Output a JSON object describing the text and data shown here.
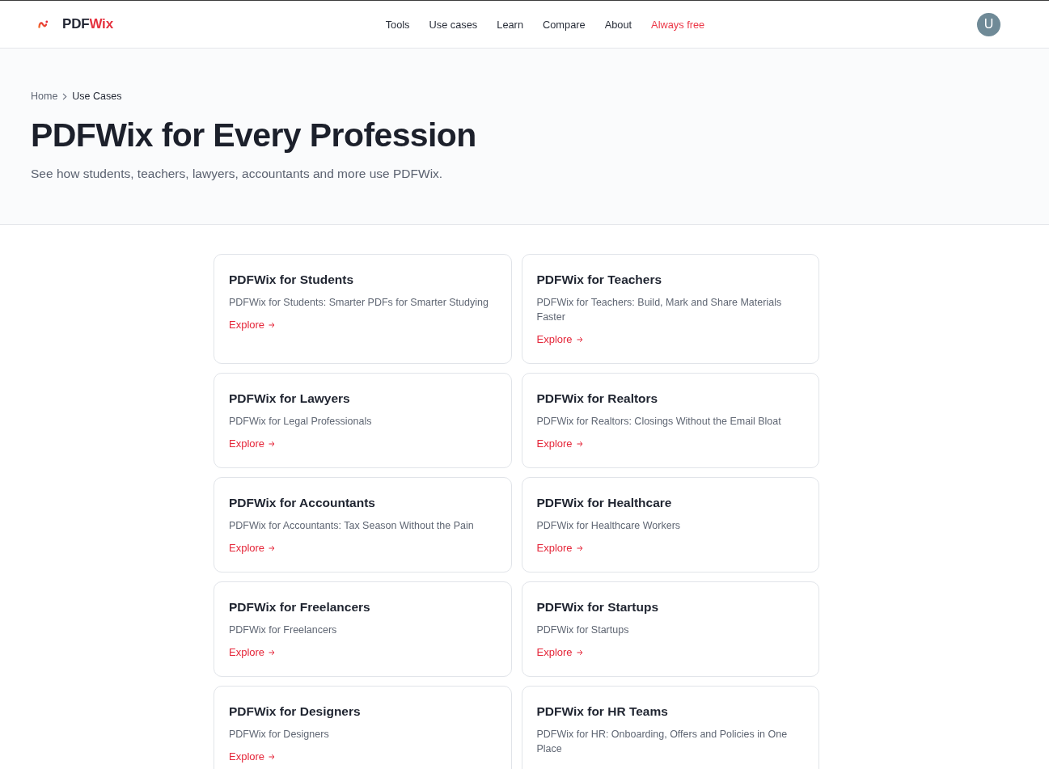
{
  "header": {
    "logo": {
      "first": "PDF",
      "second": "Wix"
    },
    "nav": [
      {
        "label": "Tools",
        "kind": "plain"
      },
      {
        "label": "Use cases",
        "kind": "plain"
      },
      {
        "label": "Learn",
        "kind": "plain"
      },
      {
        "label": "Compare",
        "kind": "plain"
      },
      {
        "label": "About",
        "kind": "plain"
      },
      {
        "label": "Always free",
        "kind": "accent"
      }
    ],
    "avatar": {
      "initial": "U"
    }
  },
  "breadcrumb": [
    {
      "label": "Home",
      "kind": "link"
    },
    {
      "label": "Use Cases",
      "kind": "current"
    }
  ],
  "hero": {
    "title": "PDFWix for Every Profession",
    "subtitle": "See how students, teachers, lawyers, accountants and more use PDFWix."
  },
  "cards": [
    {
      "title": "PDFWix for Students",
      "description": "PDFWix for Students: Smarter PDFs for Smarter Studying",
      "link": "Explore"
    },
    {
      "title": "PDFWix for Teachers",
      "description": "PDFWix for Teachers: Build, Mark and Share Materials Faster",
      "link": "Explore"
    },
    {
      "title": "PDFWix for Lawyers",
      "description": "PDFWix for Legal Professionals",
      "link": "Explore"
    },
    {
      "title": "PDFWix for Realtors",
      "description": "PDFWix for Realtors: Closings Without the Email Bloat",
      "link": "Explore"
    },
    {
      "title": "PDFWix for Accountants",
      "description": "PDFWix for Accountants: Tax Season Without the Pain",
      "link": "Explore"
    },
    {
      "title": "PDFWix for Healthcare",
      "description": "PDFWix for Healthcare Workers",
      "link": "Explore"
    },
    {
      "title": "PDFWix for Freelancers",
      "description": "PDFWix for Freelancers",
      "link": "Explore"
    },
    {
      "title": "PDFWix for Startups",
      "description": "PDFWix for Startups",
      "link": "Explore"
    },
    {
      "title": "PDFWix for Designers",
      "description": "PDFWix for Designers",
      "link": "Explore"
    },
    {
      "title": "PDFWix for HR Teams",
      "description": "PDFWix for HR: Onboarding, Offers and Policies in One Place"
    }
  ]
}
